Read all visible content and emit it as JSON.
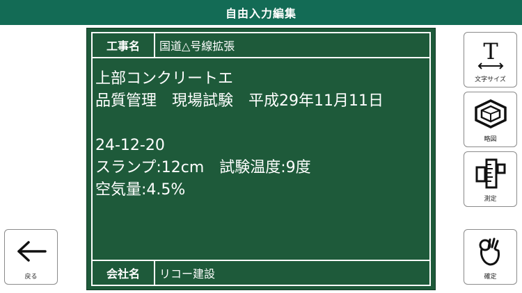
{
  "header": {
    "title": "自由入力編集"
  },
  "board": {
    "construction_label": "工事名",
    "construction_value": "国道△号線拡張",
    "lines": [
      "上部コンクリートエ",
      "品質管理　現場試験　平成29年11月11日",
      "",
      "24-12-20",
      "スランプ:12cm　試験温度:9度",
      "空気量:4.5%"
    ],
    "company_label": "会社名",
    "company_value": "リコー建設"
  },
  "buttons": {
    "text_size": {
      "label": "文字サイズ",
      "icon": "text-size-icon"
    },
    "sketch": {
      "label": "略図",
      "icon": "sketch-box-icon"
    },
    "measure": {
      "label": "測定",
      "icon": "ruler-icon"
    },
    "confirm": {
      "label": "確定",
      "icon": "ok-hand-icon"
    },
    "back": {
      "label": "戻る",
      "icon": "arrow-left-icon"
    }
  },
  "colors": {
    "header_bg": "#136b55",
    "board_bg": "#1e5a3a",
    "board_text": "#ffffff"
  }
}
